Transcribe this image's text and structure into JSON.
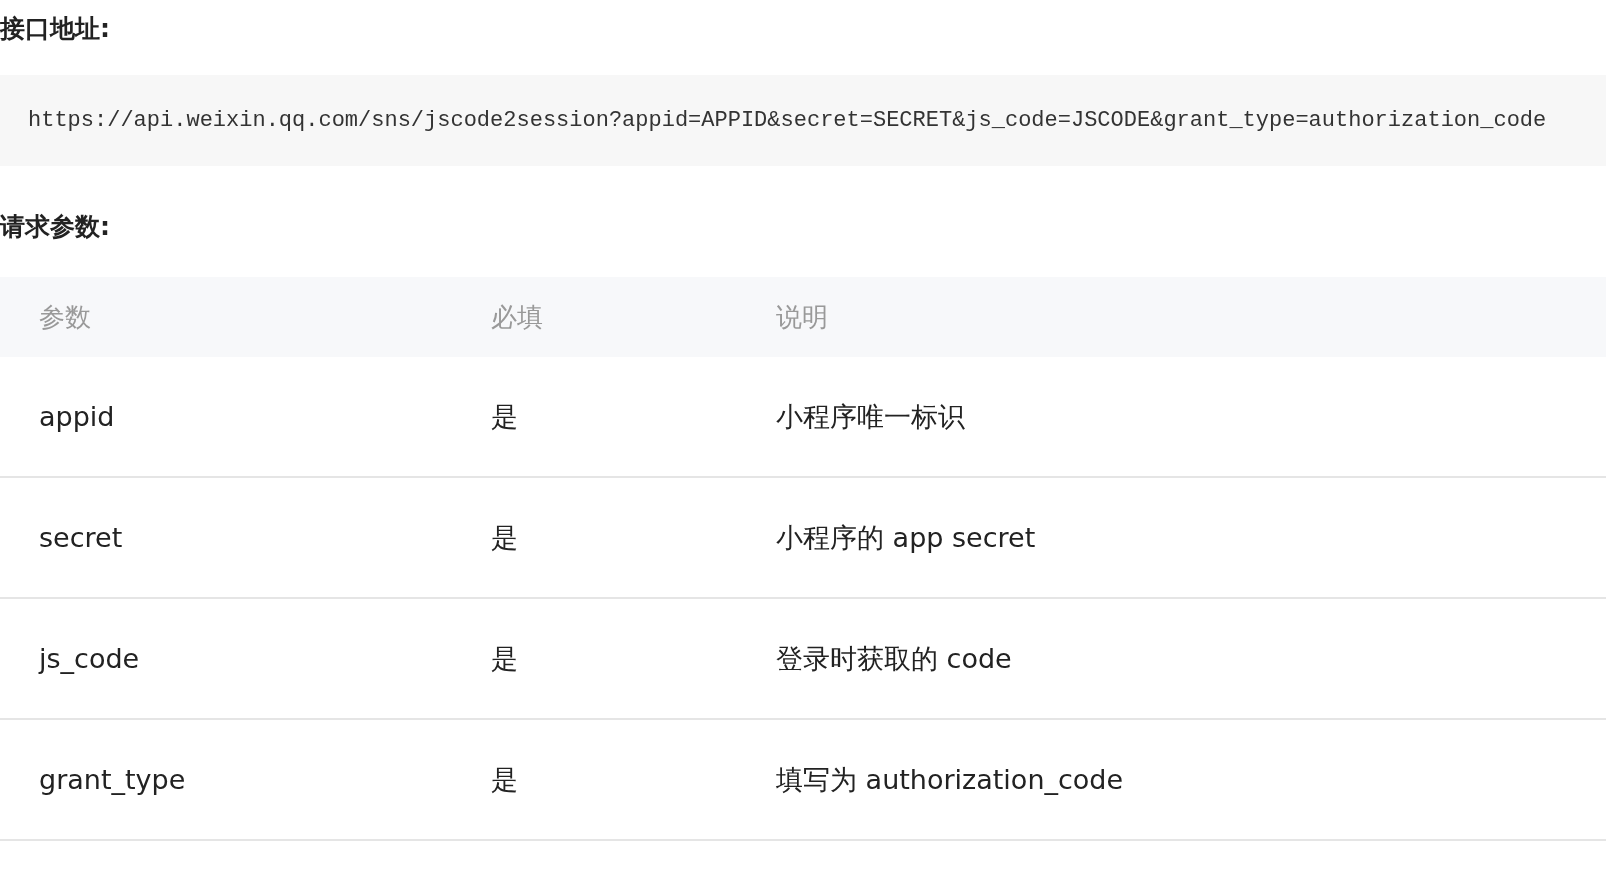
{
  "sections": [
    {
      "heading": "接口地址:",
      "kind": "code",
      "code": "https://api.weixin.qq.com/sns/jscode2session?appid=APPID&secret=SECRET&js_code=JSCODE&grant_type=authorization_code"
    },
    {
      "heading": "请求参数:",
      "kind": "table",
      "table": {
        "columns": [
          "参数",
          "必填",
          "说明"
        ],
        "rows": [
          [
            "appid",
            "是",
            "小程序唯一标识"
          ],
          [
            "secret",
            "是",
            "小程序的 app secret"
          ],
          [
            "js_code",
            "是",
            "登录时获取的 code"
          ],
          [
            "grant_type",
            "是",
            "填写为 authorization_code"
          ]
        ]
      }
    }
  ]
}
